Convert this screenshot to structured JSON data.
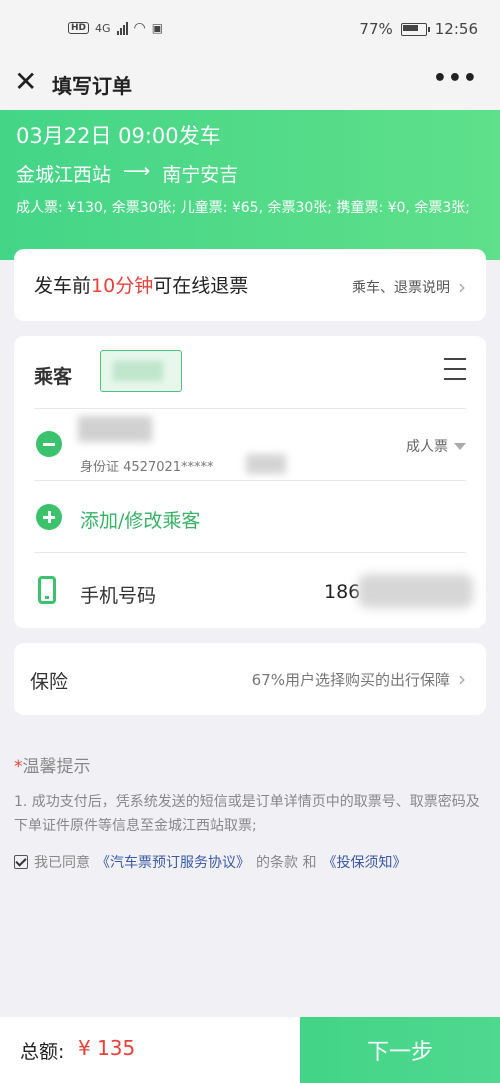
{
  "status_bar": {
    "hd": "HD",
    "network": "4G",
    "battery": "77%",
    "time": "12:56"
  },
  "nav": {
    "close_icon": "close-icon",
    "title": "填写订单",
    "more": "•••"
  },
  "trip": {
    "departure": "03月22日 09:00发车",
    "from": "金城江西站",
    "arrow": "⟶",
    "to": "南宁安吉",
    "prices": "成人票: ¥130, 余票30张; 儿童票: ¥65, 余票30张; 携童票: ¥0, 余票3张;"
  },
  "refund": {
    "prefix": "发车前",
    "highlight": "10分钟",
    "suffix": "可在线退票",
    "link": "乘车、退票说明"
  },
  "passenger": {
    "label": "乘客",
    "id_text": "身份证 4527021*****",
    "ticket_type": "成人票",
    "add_label": "添加/修改乘客",
    "phone_label": "手机号码",
    "phone_value": "186"
  },
  "insurance": {
    "label": "保险",
    "desc": "67%用户选择购买的出行保障"
  },
  "tips": {
    "star": "*",
    "title": "温馨提示",
    "body": "1. 成功支付后，凭系统发送的短信或是订单详情页中的取票号、取票密码及下单证件原件等信息至金城江西站取票;"
  },
  "agreement": {
    "prefix": "我已同意",
    "link1": "《汽车票预订服务协议》",
    "middle": "的条款 和",
    "link2": "《投保须知》"
  },
  "footer": {
    "total_label": "总额:",
    "total_amount": "¥ 135",
    "next_label": "下一步"
  },
  "colors": {
    "accent_green": "#44d587",
    "warning_red": "#e9413a",
    "link_blue": "#3a5aa6"
  }
}
